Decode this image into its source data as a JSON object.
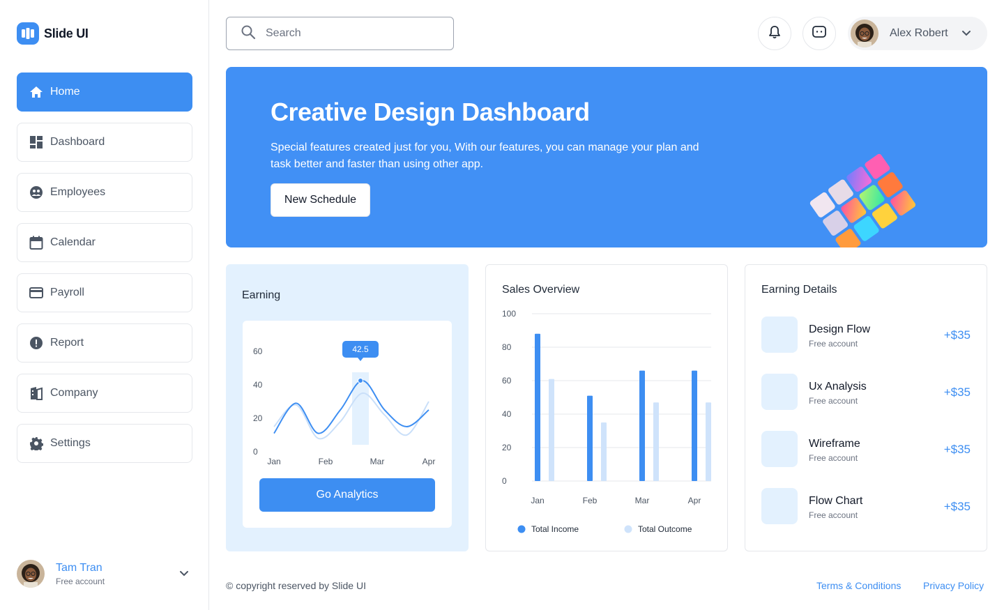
{
  "brand": {
    "name": "Slide UI"
  },
  "sidebar": {
    "items": [
      {
        "label": "Home",
        "icon": "home-icon",
        "active": true
      },
      {
        "label": "Dashboard",
        "icon": "dashboard-icon"
      },
      {
        "label": "Employees",
        "icon": "employees-icon"
      },
      {
        "label": "Calendar",
        "icon": "calendar-icon"
      },
      {
        "label": "Payroll",
        "icon": "credit-card-icon"
      },
      {
        "label": "Report",
        "icon": "alert-icon"
      },
      {
        "label": "Company",
        "icon": "building-icon"
      },
      {
        "label": "Settings",
        "icon": "gear-icon"
      }
    ],
    "user": {
      "name": "Tam Tran",
      "subtitle": "Free account"
    }
  },
  "header": {
    "search": {
      "placeholder": "Search",
      "value": ""
    },
    "profile": {
      "name": "Alex Robert"
    }
  },
  "hero": {
    "title": "Creative Design Dashboard",
    "text": "Special features created just for you, With our features, you can manage your plan and task better and faster than using other app.",
    "button": "New Schedule"
  },
  "earning": {
    "title": "Earning",
    "button": "Go Analytics",
    "chart_data": {
      "type": "line",
      "x": [
        "Jan",
        "Feb",
        "Mar",
        "Apr"
      ],
      "y_ticks": [
        0,
        20,
        40,
        60
      ],
      "ylim": [
        0,
        65
      ],
      "highlight": {
        "x": "Mar",
        "label": "42.5",
        "value": 42.5
      },
      "series": [
        {
          "color": "#3d8ef2",
          "values": [
            11,
            29,
            11,
            25,
            42.5,
            25,
            15,
            25
          ]
        },
        {
          "color": "#c9dff9",
          "values": [
            15,
            28,
            8,
            18,
            35,
            22,
            10,
            30
          ]
        }
      ]
    }
  },
  "sales": {
    "title": "Sales Overview",
    "chart_data": {
      "type": "bar",
      "categories": [
        "Jan",
        "Feb",
        "Mar",
        "Apr"
      ],
      "y_ticks": [
        0,
        20,
        40,
        60,
        80,
        100
      ],
      "ylim": [
        0,
        100
      ],
      "series": [
        {
          "name": "Total Income",
          "color": "#3d8ef2",
          "values": [
            88,
            51,
            66,
            66
          ]
        },
        {
          "name": "Total Outcome",
          "color": "#cfe3fb",
          "values": [
            61,
            35,
            47,
            47
          ]
        }
      ]
    }
  },
  "details": {
    "title": "Earning Details",
    "items": [
      {
        "name": "Design Flow",
        "subtitle": "Free account",
        "amount": "+$35"
      },
      {
        "name": "Ux Analysis",
        "subtitle": "Free account",
        "amount": "+$35"
      },
      {
        "name": "Wireframe",
        "subtitle": "Free account",
        "amount": "+$35"
      },
      {
        "name": "Flow Chart",
        "subtitle": "Free account",
        "amount": "+$35"
      }
    ]
  },
  "footer": {
    "copyright": "© copyright reserved by Slide UI",
    "terms": "Terms & Conditions",
    "privacy": "Privacy Policy"
  },
  "colors": {
    "accent": "#3d8ef2",
    "accent_light": "#e3f1fe",
    "outcome": "#cfe3fb"
  }
}
